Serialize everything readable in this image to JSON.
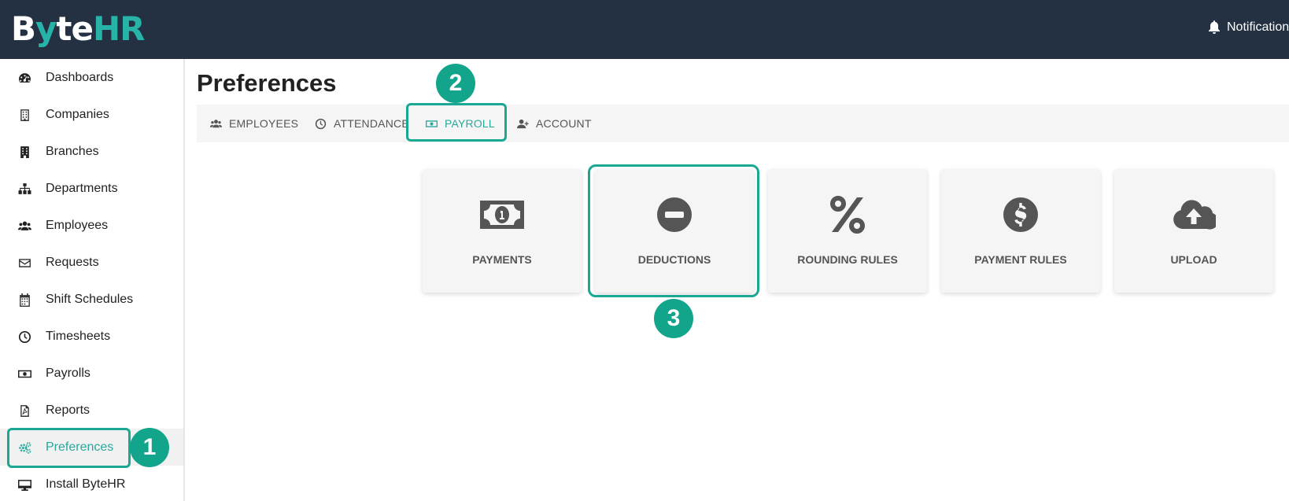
{
  "header": {
    "logo_white": "B",
    "logo_y": "y",
    "logo_te": "te",
    "logo_hr": "HR",
    "notifications_label": "Notifications"
  },
  "sidebar": {
    "items": [
      {
        "label": "Dashboards",
        "icon": "dashboard-icon"
      },
      {
        "label": "Companies",
        "icon": "building-icon"
      },
      {
        "label": "Branches",
        "icon": "building-solid-icon"
      },
      {
        "label": "Departments",
        "icon": "sitemap-icon"
      },
      {
        "label": "Employees",
        "icon": "users-icon"
      },
      {
        "label": "Requests",
        "icon": "envelope-icon"
      },
      {
        "label": "Shift Schedules",
        "icon": "calendar-icon"
      },
      {
        "label": "Timesheets",
        "icon": "clock-icon"
      },
      {
        "label": "Payrolls",
        "icon": "money-bill-icon"
      },
      {
        "label": "Reports",
        "icon": "file-pdf-icon"
      },
      {
        "label": "Preferences",
        "icon": "cogs-icon",
        "active": true
      },
      {
        "label": "Install ByteHR",
        "icon": "desktop-icon"
      }
    ]
  },
  "main": {
    "title": "Preferences",
    "tabs": [
      {
        "label": "EMPLOYEES",
        "icon": "users-icon"
      },
      {
        "label": "ATTENDANCE",
        "icon": "clock-icon"
      },
      {
        "label": "PAYROLL",
        "icon": "money-bill-icon",
        "active": true
      },
      {
        "label": "ACCOUNT",
        "icon": "user-plus-icon"
      }
    ],
    "cards": [
      {
        "label": "PAYMENTS",
        "icon": "money-bill-icon"
      },
      {
        "label": "DEDUCTIONS",
        "icon": "minus-circle-icon"
      },
      {
        "label": "ROUNDING RULES",
        "icon": "percent-icon"
      },
      {
        "label": "PAYMENT RULES",
        "icon": "dollar-circle-icon"
      },
      {
        "label": "UPLOAD",
        "icon": "cloud-upload-icon"
      }
    ]
  },
  "annotations": {
    "step1": "1",
    "step2": "2",
    "step3": "3"
  },
  "colors": {
    "header_bg": "#243142",
    "accent": "#27a99d",
    "highlight": "#1aa893"
  }
}
